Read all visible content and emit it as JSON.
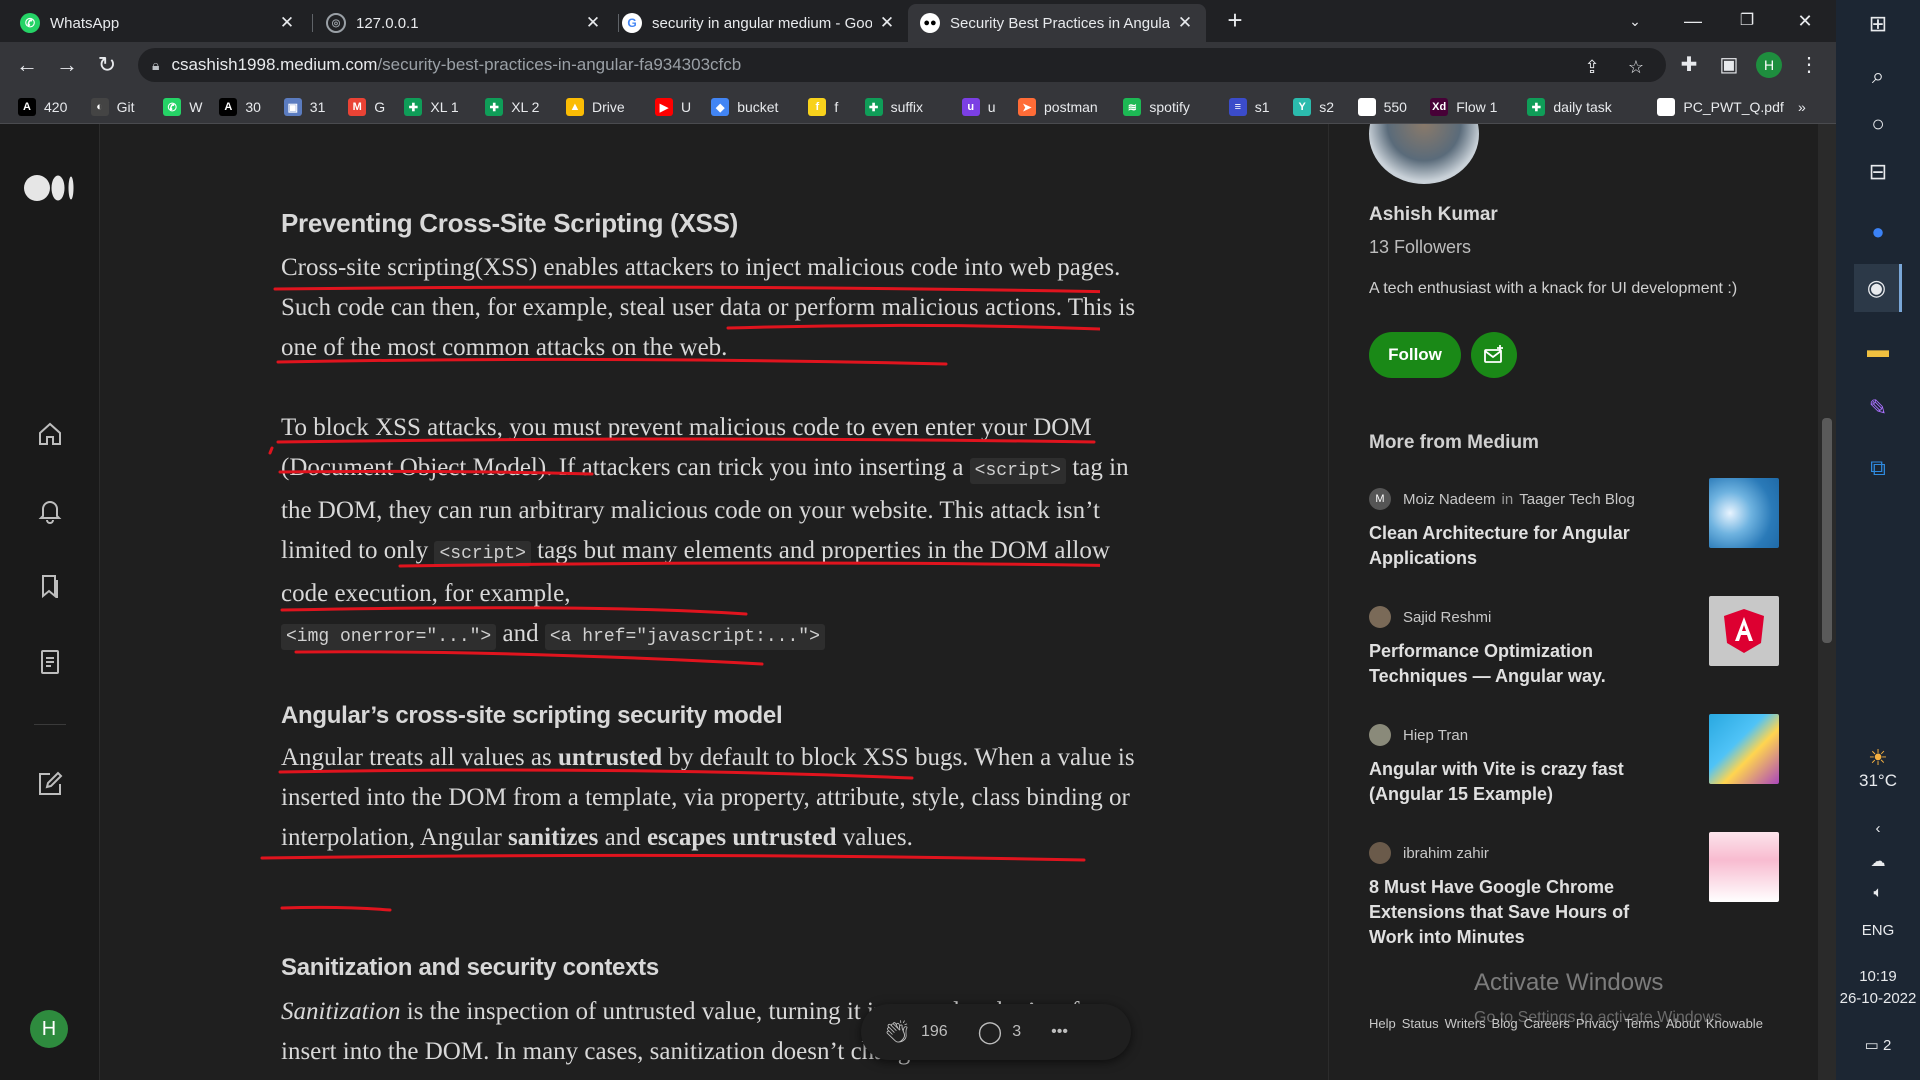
{
  "browser": {
    "tabs": [
      {
        "title": "WhatsApp",
        "icon": "whatsapp-icon",
        "color": "#25d366"
      },
      {
        "title": "127.0.0.1",
        "icon": "globe-icon",
        "color": "#9aa0a6"
      },
      {
        "title": "security in angular medium - Goo",
        "icon": "google-icon",
        "color": "#ffffff"
      },
      {
        "title": "Security Best Practices in Angular",
        "icon": "medium-icon",
        "color": "#ffffff"
      }
    ],
    "url_host": "csashish1998.medium.com",
    "url_path": "/security-best-practices-in-angular-fa934303cfcb",
    "profile_initial": "H",
    "bookmarks": [
      {
        "label": "420",
        "icon": "A",
        "color": "#000000"
      },
      {
        "label": "Git",
        "icon": "github-icon",
        "color": "#444444"
      },
      {
        "label": "W",
        "icon": "whatsapp-icon",
        "color": "#25d366"
      },
      {
        "label": "30",
        "icon": "A",
        "color": "#000000"
      },
      {
        "label": "31",
        "icon": "image-icon",
        "color": "#5b7cc0"
      },
      {
        "label": "G",
        "icon": "gmail-icon",
        "color": "#ea4335"
      },
      {
        "label": "XL 1",
        "icon": "sheets-icon",
        "color": "#0f9d58"
      },
      {
        "label": "XL 2",
        "icon": "sheets-icon",
        "color": "#0f9d58"
      },
      {
        "label": "Drive",
        "icon": "drive-icon",
        "color": "#fbbc04"
      },
      {
        "label": "U",
        "icon": "youtube-icon",
        "color": "#ff0000"
      },
      {
        "label": "bucket",
        "icon": "bucket-icon",
        "color": "#4285f4"
      },
      {
        "label": "f",
        "icon": "flipkart-icon",
        "color": "#f8d21c"
      },
      {
        "label": "suffix",
        "icon": "sheets-icon",
        "color": "#0f9d58"
      },
      {
        "label": "u",
        "icon": "u-icon",
        "color": "#7b3fe4"
      },
      {
        "label": "postman",
        "icon": "postman-icon",
        "color": "#ff6c37"
      },
      {
        "label": "spotify",
        "icon": "spotify-icon",
        "color": "#1db954"
      },
      {
        "label": "s1",
        "icon": "s-icon",
        "color": "#3b4cca"
      },
      {
        "label": "s2",
        "icon": "y-icon",
        "color": "#2bbbad"
      },
      {
        "label": "550",
        "icon": "bookmark-icon",
        "color": "#ffffff"
      },
      {
        "label": "Flow 1",
        "icon": "xd-icon",
        "color": "#470137"
      },
      {
        "label": "daily task",
        "icon": "sheets-icon",
        "color": "#0f9d58"
      },
      {
        "label": "PC_PWT_Q.pdf",
        "icon": "chrome-icon",
        "color": "#ffffff"
      }
    ],
    "bookmarks_more": "»"
  },
  "article": {
    "h_xss": "Preventing Cross-Site Scripting (XSS)",
    "p1": "Cross-site scripting(XSS) enables attackers to inject malicious code into web pages. Such code can then, for example, steal user data or perform malicious actions. This is one of the most common attacks on the web.",
    "p2_a": "To block XSS attacks, you must prevent malicious code to even enter your DOM (Document Object Model). If attackers can trick you into inserting a ",
    "p2_code1": "<script>",
    "p2_b": " tag in the DOM, they can run arbitrary malicious code on your website. This attack isn’t limited to only ",
    "p2_code2": "<script>",
    "p2_c": " tags but many elements and properties in the DOM allow code execution, for example, ",
    "p2_code3": "<img onerror=\"...\">",
    "p2_and": " and ",
    "p2_code4": "<a href=\"javascript:...\">",
    "h_model": "Angular’s cross-site scripting security model",
    "p3_a": "Angular treats all values as ",
    "p3_untrusted": "untrusted",
    "p3_b": " by default to block XSS bugs. When a value is inserted into the DOM from a template, via property, attribute, style, class binding or interpolation, Angular ",
    "p3_sanitizes": "sanitizes",
    "p3_and": " and ",
    "p3_escapes": "escapes untrusted",
    "p3_c": " values.",
    "h_sanitization": "Sanitization and security contexts",
    "p4_i": "Sanitization",
    "p4_a": " is the inspection of untrusted value, turning it into a value that’s safe to insert into the DOM. In many cases, sanitization doesn’t change a"
  },
  "clapbar": {
    "claps": "196",
    "responses": "3",
    "more": "•••"
  },
  "sidebar": {
    "author_name": "Ashish Kumar",
    "followers": "13 Followers",
    "bio": "A tech enthusiast with a knack for UI development :)",
    "follow_label": "Follow",
    "more_title": "More from Medium",
    "recommendations": [
      {
        "author": "Moiz Nadeem",
        "in": "in",
        "publication": "Taager Tech Blog",
        "title": "Clean Architecture for Angular Applications",
        "avatar": "M"
      },
      {
        "author": "Sajid Reshmi",
        "in": "",
        "publication": "",
        "title": "Performance Optimization Techniques — Angular way.",
        "avatar": ""
      },
      {
        "author": "Hiep Tran",
        "in": "",
        "publication": "",
        "title": "Angular with Vite is crazy fast (Angular 15 Example)",
        "avatar": ""
      },
      {
        "author": "ibrahim zahir",
        "in": "",
        "publication": "",
        "title": "8 Must Have Google Chrome Extensions that Save Hours of Work into Minutes",
        "avatar": ""
      }
    ],
    "footer": [
      "Help",
      "Status",
      "Writers",
      "Blog",
      "Careers",
      "Privacy",
      "Terms",
      "About",
      "Knowable"
    ]
  },
  "watermark": {
    "title": "Activate Windows",
    "sub": "Go to Settings to activate Windows."
  },
  "taskbar": {
    "weather": "31°C",
    "language": "ENG",
    "time": "10:19",
    "date": "26-10-2022",
    "notifications": "2"
  },
  "colors": {
    "accent": "#1a8917",
    "annotation": "#e0141e",
    "medium_bg": "#1f1f1f"
  }
}
